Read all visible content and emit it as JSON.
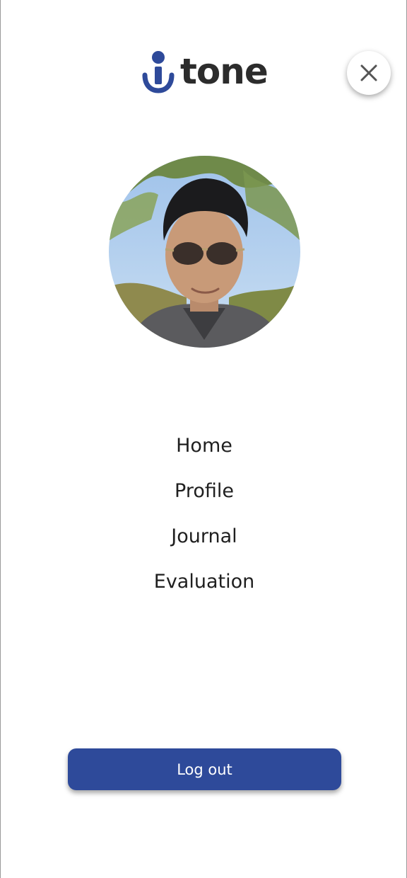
{
  "app": {
    "brand_name": "tone",
    "logo_icon": "anchor-i-icon",
    "brand_color": "#2e4a9a",
    "text_color": "#2c2c2c"
  },
  "header": {
    "close_icon": "close-icon"
  },
  "profile": {
    "avatar": "user-photo"
  },
  "menu": {
    "items": [
      {
        "label": "Home"
      },
      {
        "label": "Profile"
      },
      {
        "label": "Journal"
      },
      {
        "label": "Evaluation"
      }
    ]
  },
  "footer": {
    "logout_label": "Log out"
  }
}
